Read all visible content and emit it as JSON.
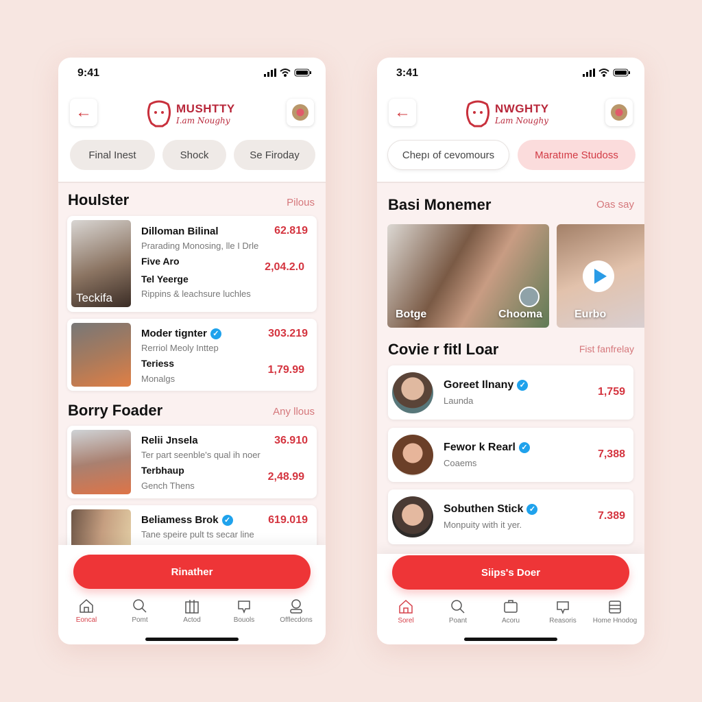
{
  "left": {
    "status": {
      "time": "9:41"
    },
    "logo": {
      "title": "MUSHTTY",
      "tagline": "I.am Noughy"
    },
    "chips": [
      "Final Inest",
      "Shock",
      "Se Firoday"
    ],
    "section1": {
      "title": "Houlster",
      "link": "Pilous"
    },
    "cards1": [
      {
        "photo_caption": "Teckifa",
        "name": "Dilloman Bilinal",
        "sub": "Prarading Monosing, lle I Drle",
        "price": "62.819",
        "name2": "Five Aro",
        "price2": "2,04.2.0",
        "name3": "Tel Yeerge",
        "sub3": "Rippins & leachsure luchles"
      },
      {
        "name": "Moder tignter",
        "verified": true,
        "sub": "Rerriol Meoly Inttep",
        "price": "303.219",
        "name2": "Teriess",
        "sub2": "Monalgs",
        "price2": "1,79.99"
      }
    ],
    "section2": {
      "title": "Borry Foader",
      "link": "Any llous"
    },
    "cards2": [
      {
        "name": "Relii Jnsela",
        "sub": "Ter part seenble's qual ih noer",
        "price": "36.910",
        "name2": "Terbhaup",
        "sub2": "Gench Thens",
        "price2": "2,48.99"
      },
      {
        "name": "Beliamess Brok",
        "verified": true,
        "sub": "Tane speire pult ts secar line",
        "price": "619.019"
      }
    ],
    "cta": "Rinather",
    "nav": [
      {
        "label": "Eoncal",
        "icon": "home-icon",
        "active": true
      },
      {
        "label": "Pomt",
        "icon": "search-icon"
      },
      {
        "label": "Actod",
        "icon": "building-icon"
      },
      {
        "label": "Bouols",
        "icon": "chat-icon"
      },
      {
        "label": "Offlecdons",
        "icon": "person-icon"
      }
    ]
  },
  "right": {
    "status": {
      "time": "3:41"
    },
    "logo": {
      "title": "NWGHTY",
      "tagline": "Lam Noughy"
    },
    "chips": [
      {
        "label": "Chepı of cevomours",
        "active": false
      },
      {
        "label": "Maratıme Studoss",
        "active": true
      }
    ],
    "section1": {
      "title": "Basi Monemer",
      "link": "Oas say"
    },
    "media": [
      {
        "label": "Botge",
        "label2": "Chooma"
      },
      {
        "label": "Eurbo",
        "play": true
      }
    ],
    "section2": {
      "title": "Covie r fitl Loar",
      "link": "Fist fanfrelay"
    },
    "list": [
      {
        "name": "Goreet Ilnany",
        "sub": "Launda",
        "price": "1,759",
        "verified": true
      },
      {
        "name": "Fewor k Rearl",
        "sub": "Coaems",
        "price": "7,388",
        "verified": true
      },
      {
        "name": "Sobuthen Stick",
        "sub": "Monpuity with it yer.",
        "price": "7.389",
        "verified": true
      }
    ],
    "cta": "Siips's Doer",
    "nav": [
      {
        "label": "Sorel",
        "icon": "home-icon",
        "active": true
      },
      {
        "label": "Poant",
        "icon": "search-icon"
      },
      {
        "label": "Acoru",
        "icon": "bag-icon"
      },
      {
        "label": "Reasoris",
        "icon": "chat-icon"
      },
      {
        "label": "Home Hnodog",
        "icon": "inbox-icon"
      }
    ]
  },
  "colors": {
    "accent": "#ee3537",
    "price": "#d4343f",
    "link": "#d5777b",
    "verified": "#1fa2ec",
    "background": "#f7e6e1"
  }
}
